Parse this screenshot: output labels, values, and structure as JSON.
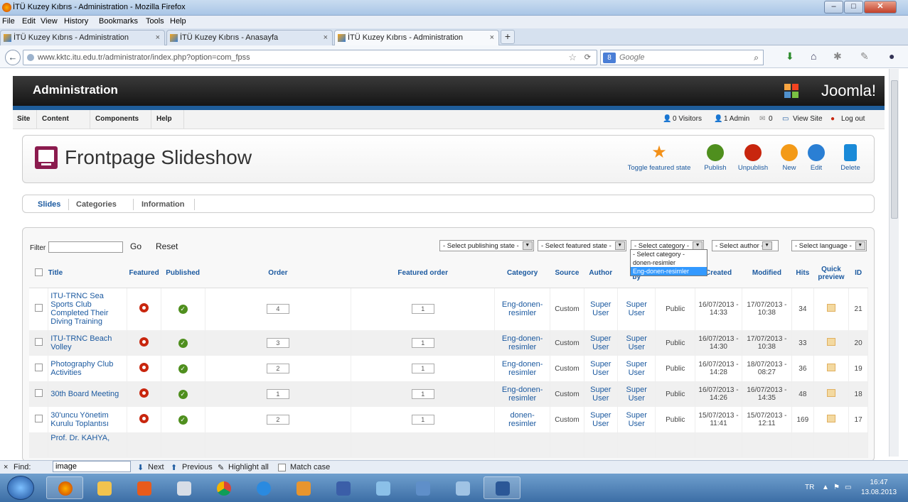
{
  "window": {
    "title": "İTÜ Kuzey Kıbrıs - Administration - Mozilla Firefox"
  },
  "menu": [
    "File",
    "Edit",
    "View",
    "History",
    "Bookmarks",
    "Tools",
    "Help"
  ],
  "tabs": [
    {
      "label": "İTÜ Kuzey Kıbrıs - Administration"
    },
    {
      "label": "İTÜ Kuzey Kıbrıs - Anasayfa"
    },
    {
      "label": "İTÜ Kuzey Kıbrıs - Administration"
    }
  ],
  "address": {
    "url": "www.kktc.itu.edu.tr/administrator/index.php?option=com_fpss"
  },
  "search": {
    "placeholder": "Google"
  },
  "joomla": {
    "header": "Administration",
    "logo": "Joomla!",
    "menu": [
      "Site",
      "Content",
      "Components",
      "Help"
    ],
    "status": {
      "visitors": "0 Visitors",
      "admin": "1 Admin",
      "messages": "0",
      "view_site": "View Site",
      "logout": "Log out"
    },
    "page_title": "Frontpage Slideshow",
    "toolbar": [
      "Toggle featured state",
      "Publish",
      "Unpublish",
      "New",
      "Edit",
      "Delete"
    ],
    "subnav": [
      "Slides",
      "Categories",
      "Information"
    ]
  },
  "filter": {
    "label": "Filter",
    "value": "",
    "go": "Go",
    "reset": "Reset"
  },
  "selects": {
    "publishing": "- Select publishing state -",
    "featured": "- Select featured state -",
    "category": "- Select category -",
    "author": "- Select author -",
    "language": "- Select language -"
  },
  "category_dropdown": [
    "- Select category -",
    "donen-resimler",
    "Eng-donen-resimler"
  ],
  "columns": [
    "Title",
    "Featured",
    "Published",
    "Order",
    "Featured order",
    "Category",
    "Source",
    "Author",
    "m",
    "by",
    "level",
    "Created",
    "Modified",
    "Hits",
    "Quick preview",
    "ID"
  ],
  "rows": [
    {
      "title": "ITU-TRNC Sea Sports Club Completed Their Diving Training",
      "order": "4",
      "forder": "1",
      "category": "Eng-donen-resimler",
      "source": "Custom",
      "author": "Super User",
      "modby": "Super User",
      "access": "Public",
      "created": "16/07/2013 - 14:33",
      "modified": "17/07/2013 - 10:38",
      "hits": "34",
      "id": "21"
    },
    {
      "title": "ITU-TRNC Beach Volley",
      "order": "3",
      "forder": "1",
      "category": "Eng-donen-resimler",
      "source": "Custom",
      "author": "Super User",
      "modby": "Super User",
      "access": "Public",
      "created": "16/07/2013 - 14:30",
      "modified": "17/07/2013 - 10:38",
      "hits": "33",
      "id": "20"
    },
    {
      "title": "Photography Club Activities",
      "order": "2",
      "forder": "1",
      "category": "Eng-donen-resimler",
      "source": "Custom",
      "author": "Super User",
      "modby": "Super User",
      "access": "Public",
      "created": "16/07/2013 - 14:28",
      "modified": "18/07/2013 - 08:27",
      "hits": "36",
      "id": "19"
    },
    {
      "title": "30th Board Meeting",
      "order": "1",
      "forder": "1",
      "category": "Eng-donen-resimler",
      "source": "Custom",
      "author": "Super User",
      "modby": "Super User",
      "access": "Public",
      "created": "16/07/2013 - 14:26",
      "modified": "16/07/2013 - 14:35",
      "hits": "48",
      "id": "18"
    },
    {
      "title": "30'uncu Yönetim Kurulu Toplantısı",
      "order": "2",
      "forder": "1",
      "category": "donen-resimler",
      "source": "Custom",
      "author": "Super User",
      "modby": "Super User",
      "access": "Public",
      "created": "15/07/2013 - 11:41",
      "modified": "15/07/2013 - 12:11",
      "hits": "169",
      "id": "17"
    },
    {
      "title": "Prof. Dr. KAHYA,",
      "order": "",
      "forder": "",
      "category": "",
      "source": "",
      "author": "",
      "modby": "",
      "access": "",
      "created": "",
      "modified": "",
      "hits": "",
      "id": ""
    }
  ],
  "find": {
    "label": "Find:",
    "value": "image",
    "next": "Next",
    "previous": "Previous",
    "highlight": "Highlight all",
    "match": "Match case"
  },
  "tray": {
    "lang": "TR",
    "time": "16:47",
    "date": "13.08.2013"
  }
}
